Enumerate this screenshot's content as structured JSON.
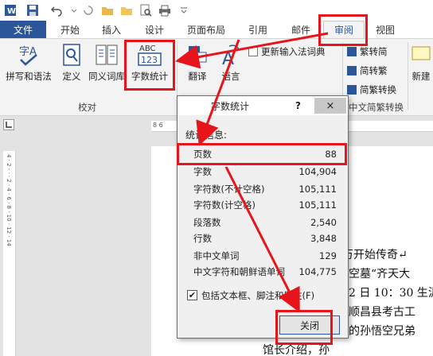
{
  "tabs": {
    "file": "文件",
    "items": [
      "开始",
      "插入",
      "设计",
      "页面布局",
      "引用",
      "邮件",
      "审阅",
      "视图"
    ],
    "active": "审阅"
  },
  "ribbon": {
    "proofing": {
      "buttons": [
        "拼写和语法",
        "定义",
        "同义词库",
        "字数统计"
      ],
      "group_label": "校对",
      "abc_text": "ABC",
      "num_text": "123",
      "spell_letter": "字A"
    },
    "language": {
      "translate": "翻译",
      "language": "语言",
      "update_ime": "更新输入法词典"
    },
    "chinese": {
      "items": [
        "繁转简",
        "简转繁",
        "简繁转换"
      ],
      "group_label": "中文简繁转换"
    },
    "new_comment": "新建"
  },
  "ruler": {
    "h_ticks": "8  6",
    "v_ticks": "4 · 2 · · · 2 · 4 · 6 · 8 · 10 · 12 · 14"
  },
  "document": {
    "lines": [
      "万开始传奇↵",
      "空墓“齐天大",
      "2 日 10：30 生汎",
      "顺昌县考古工",
      "的孙悟空兄弟",
      "馆长介绍，孙"
    ]
  },
  "dialog": {
    "title": "字数统计",
    "help": "?",
    "close_x": "×",
    "section_label": "统计信息:",
    "stats": [
      {
        "label": "页数",
        "value": "88"
      },
      {
        "label": "字数",
        "value": "104,904"
      },
      {
        "label": "字符数(不计空格)",
        "value": "105,111"
      },
      {
        "label": "字符数(计空格)",
        "value": "105,111"
      },
      {
        "label": "段落数",
        "value": "2,540"
      },
      {
        "label": "行数",
        "value": "3,848"
      },
      {
        "label": "非中文单词",
        "value": "129"
      },
      {
        "label": "中文字符和朝鲜语单词",
        "value": "104,775"
      }
    ],
    "checkbox_label": "包括文本框、脚注和尾注(F)",
    "checkbox_checked": "✔",
    "close_button": "关闭"
  },
  "colors": {
    "file_tab": "#2b579a",
    "highlight": "#e8141c"
  }
}
